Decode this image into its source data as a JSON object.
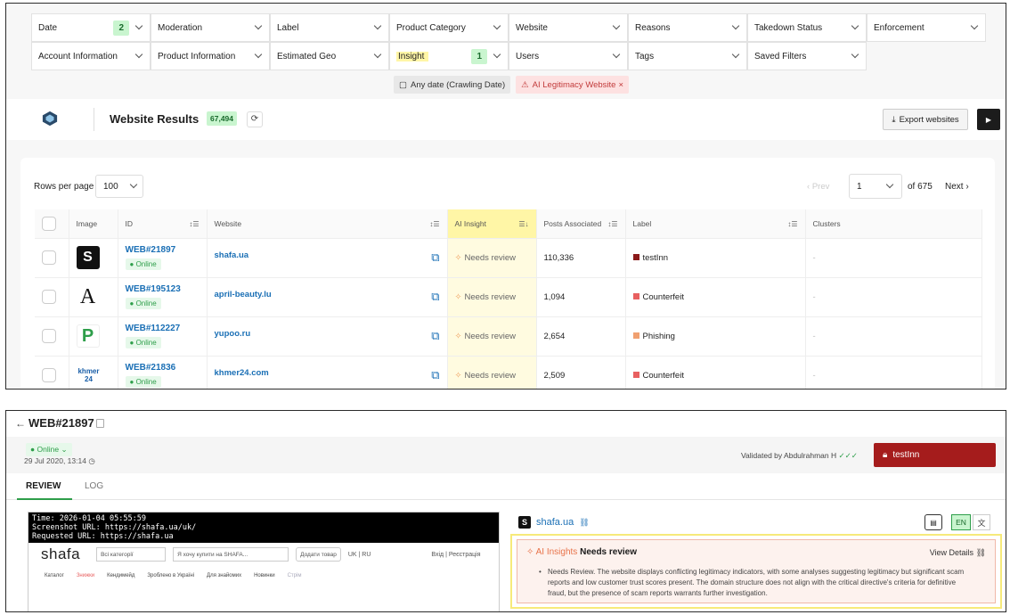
{
  "filters": {
    "row1": [
      {
        "label": "Date",
        "count": "2"
      },
      {
        "label": "Moderation"
      },
      {
        "label": "Label"
      },
      {
        "label": "Product Category"
      },
      {
        "label": "Website"
      },
      {
        "label": "Reasons"
      },
      {
        "label": "Takedown Status"
      },
      {
        "label": "Enforcement"
      }
    ],
    "row2": [
      {
        "label": "Account Information"
      },
      {
        "label": "Product Information"
      },
      {
        "label": "Estimated Geo"
      },
      {
        "label": "Insight",
        "count": "1"
      },
      {
        "label": "Users"
      },
      {
        "label": "Tags"
      },
      {
        "label": "Saved Filters"
      }
    ],
    "chips": [
      "Any date (Crawling Date)",
      "AI Legitimacy Website"
    ]
  },
  "header": {
    "title": "Website Results",
    "count": "67,494",
    "export_label": "Export websites"
  },
  "pagination": {
    "rows_per_page_label": "Rows per page",
    "rows_per_page": "100",
    "prev": "Prev",
    "page": "1",
    "of": "of 675",
    "next": "Next"
  },
  "columns": [
    "Image",
    "ID",
    "Website",
    "AI Insight",
    "Posts Associated",
    "Label",
    "Clusters"
  ],
  "rows": [
    {
      "thumb": "S",
      "id": "WEB#21897",
      "status": "Online",
      "website": "shafa.ua",
      "insight": "Needs review",
      "posts": "110,336",
      "label": "testInn",
      "label_color": "#8b1a1a",
      "clusters": "-"
    },
    {
      "thumb": "A",
      "id": "WEB#195123",
      "status": "Online",
      "website": "april-beauty.lu",
      "insight": "Needs review",
      "posts": "1,094",
      "label": "Counterfeit",
      "label_color": "#e86060",
      "clusters": "-"
    },
    {
      "thumb": "P",
      "id": "WEB#112227",
      "status": "Online",
      "website": "yupoo.ru",
      "insight": "Needs review",
      "posts": "2,654",
      "label": "Phishing",
      "label_color": "#f0a070",
      "clusters": "-"
    },
    {
      "thumb": "khmer 24",
      "id": "WEB#21836",
      "status": "Online",
      "website": "khmer24.com",
      "insight": "Needs review",
      "posts": "2,509",
      "label": "Counterfeit",
      "label_color": "#e86060",
      "clusters": "-"
    }
  ],
  "detail": {
    "title": "WEB#21897",
    "status": "Online",
    "date": "29 Jul 2020, 13:14",
    "validated": "Validated by Abdulrahman H",
    "label_button": "testInn",
    "tabs": [
      "REVIEW",
      "LOG"
    ],
    "screenshot": {
      "line1": "Time: 2026-01-04 05:55:59",
      "line2": "Screenshot URL: https://shafa.ua/uk/",
      "line3": "Requested URL: https://shafa.ua",
      "logo": "shafa",
      "category": "Всі категорії",
      "search": "Я хочу купити на SHAFA...",
      "sell": "Додати товар",
      "langs": "UK | RU",
      "login": "Вхід | Реєстрація",
      "menu": [
        "Каталог",
        "Знижки",
        "Кендимейд",
        "Зроблено в Україні",
        "Для знайомих",
        "Новинки",
        "Стрім"
      ]
    },
    "site": "shafa.ua",
    "lang_en": "EN",
    "lang_icon": "文",
    "ai_title": "AI Insights",
    "ai_status": "Needs review",
    "view_details": "View Details",
    "ai_text": "Needs Review. The website displays conflicting legitimacy indicators, with some analyses suggesting legitimacy but significant scam reports and low customer trust scores present. The domain structure does not align with the critical directive's criteria for definitive fraud, but the presence of scam reports warrants further investigation."
  }
}
